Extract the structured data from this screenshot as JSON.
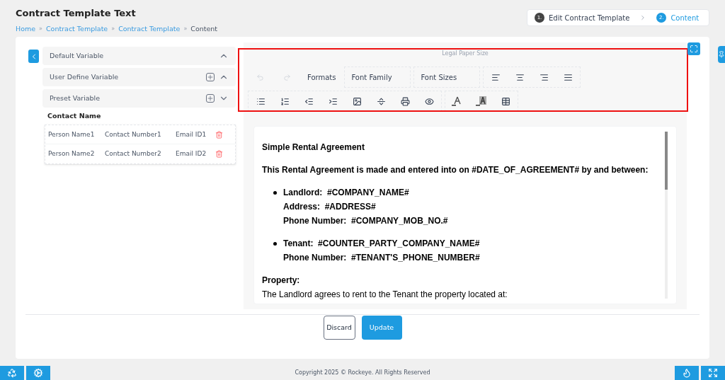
{
  "header": {
    "title": "Contract Template Text",
    "separator": "»",
    "breadcrumb": [
      {
        "label": "Home",
        "link": true
      },
      {
        "label": "Contract Template",
        "link": true
      },
      {
        "label": "Contract Template",
        "link": true
      },
      {
        "label": "Content",
        "link": false
      }
    ],
    "steps": [
      {
        "number": "1.",
        "label": "Edit Contract Template",
        "selected": false
      },
      {
        "number": "2.",
        "label": "Content",
        "selected": true
      }
    ]
  },
  "variables": {
    "sections": [
      {
        "label": "Default Variable",
        "expanded": true,
        "addable": false
      },
      {
        "label": "User Define Variable",
        "expanded": true,
        "addable": true
      },
      {
        "label": "Preset Variable",
        "expanded": false,
        "addable": true
      }
    ],
    "table_title": "Contact Name",
    "rows": [
      {
        "name": "Person Name1",
        "number": "Contact Number1",
        "email": "Email ID1"
      },
      {
        "name": "Person Name2",
        "number": "Contact Number2",
        "email": "Email ID2"
      }
    ]
  },
  "editor": {
    "paper_size": "Legal Paper Size",
    "formats": "Formats",
    "font_family": "Font Family",
    "font_sizes": "Font Sizes",
    "document": [
      {
        "kind": "heading",
        "text": "Simple Rental Agreement"
      },
      {
        "kind": "heading",
        "text": "This Rental Agreement is made and entered into on  #DATE_OF_AGREEMENT#  by and between:"
      },
      {
        "kind": "bullet",
        "lines": [
          "Landlord:  #COMPANY_NAME#",
          "Address:  #ADDRESS#",
          "Phone Number:  #COMPANY_MOB_NO.#"
        ]
      },
      {
        "kind": "bullet",
        "lines": [
          "Tenant:  #COUNTER_PARTY_COMPANY_NAME#",
          "Phone Number:  #TENANT'S_PHONE_NUMBER#"
        ]
      },
      {
        "kind": "label",
        "text": "Property:"
      },
      {
        "kind": "text",
        "text": "The Landlord agrees to rent to the Tenant the property located at:"
      }
    ]
  },
  "buttons": {
    "discard": "Discard",
    "update": "Update"
  },
  "footer": {
    "copyright": "Copyright 2025 © Rockeye. All Rights Reserved"
  }
}
